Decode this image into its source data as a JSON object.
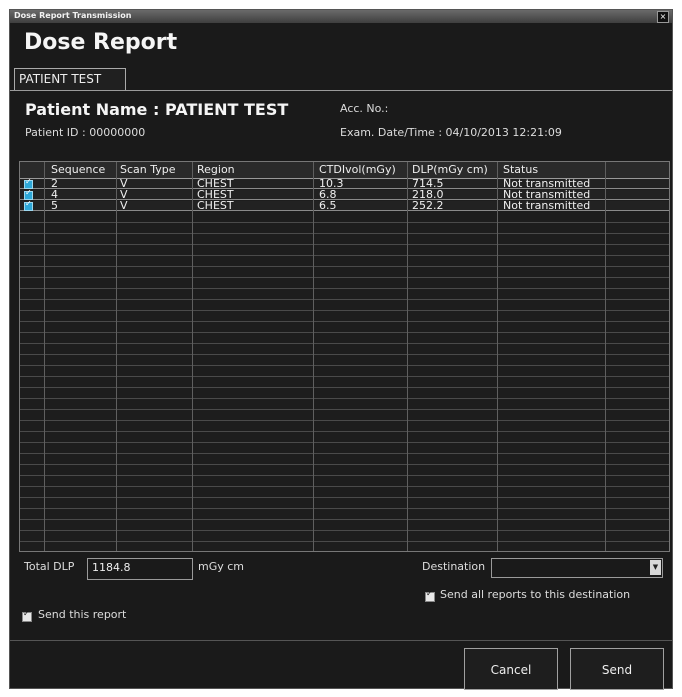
{
  "window": {
    "title": "Dose Report Transmission",
    "close_glyph": "×"
  },
  "heading": "Dose Report",
  "tab": {
    "label": "PATIENT  TEST"
  },
  "patient": {
    "name": "Patient Name : PATIENT  TEST",
    "id": "Patient ID : 00000000",
    "acc": "Acc. No.:",
    "exam": "Exam. Date/Time : 04/10/2013  12:21:09"
  },
  "table": {
    "headers": [
      "Sequence",
      "Scan Type",
      "Region",
      "CTDIvol(mGy)",
      "DLP(mGy cm)",
      "Status"
    ],
    "rows": [
      {
        "sequence": "2",
        "scan_type": "V",
        "region": "CHEST",
        "ctdivol": "10.3",
        "dlp": "714.5",
        "status": "Not transmitted",
        "checked": true
      },
      {
        "sequence": "4",
        "scan_type": "V",
        "region": "CHEST",
        "ctdivol": "6.8",
        "dlp": "218.0",
        "status": "Not transmitted",
        "checked": true
      },
      {
        "sequence": "5",
        "scan_type": "V",
        "region": "CHEST",
        "ctdivol": "6.5",
        "dlp": "252.2",
        "status": "Not transmitted",
        "checked": true
      }
    ]
  },
  "total": {
    "label": "Total DLP",
    "value": "1184.8",
    "unit": "mGy cm"
  },
  "destination": {
    "label": "Destination",
    "value": "",
    "send_all_label": "Send all reports to this destination"
  },
  "send_this": {
    "label": "Send this report"
  },
  "buttons": {
    "cancel": "Cancel",
    "send": "Send"
  },
  "colors": {
    "background": "#1a1a1a",
    "checkbox_accent": "#2ea8d8"
  }
}
